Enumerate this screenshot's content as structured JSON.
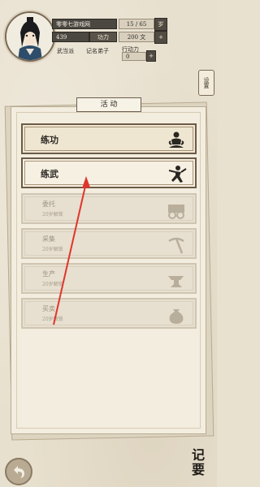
{
  "header": {
    "player_name": "零零七游戏网",
    "health": "15 / 65",
    "health_suffix": "岁",
    "exp_value": "439",
    "exp_label": "功力",
    "money_value": "200 文",
    "faction": "武当派",
    "rank": "记名弟子",
    "action_label": "行动力",
    "action_value": "0"
  },
  "settings_label": "设置",
  "panel": {
    "title": "活 动",
    "items": [
      {
        "label": "练功",
        "sub": "",
        "icon": "meditation-icon",
        "state": "enabled"
      },
      {
        "label": "练武",
        "sub": "",
        "icon": "martial-arts-icon",
        "state": "selected"
      },
      {
        "label": "委托",
        "sub": "20岁解锁",
        "icon": "cart-icon",
        "state": "disabled"
      },
      {
        "label": "采集",
        "sub": "20岁解锁",
        "icon": "pickaxe-icon",
        "state": "disabled"
      },
      {
        "label": "生产",
        "sub": "20岁解锁",
        "icon": "anvil-icon",
        "state": "disabled"
      },
      {
        "label": "买卖",
        "sub": "20岁解锁",
        "icon": "money-bag-icon",
        "state": "disabled"
      }
    ]
  },
  "footer": {
    "memo_label": "记要"
  },
  "colors": {
    "arrow": "#e0352b",
    "dark_bar": "#4b4741",
    "panel_bg": "#f3eddf"
  }
}
